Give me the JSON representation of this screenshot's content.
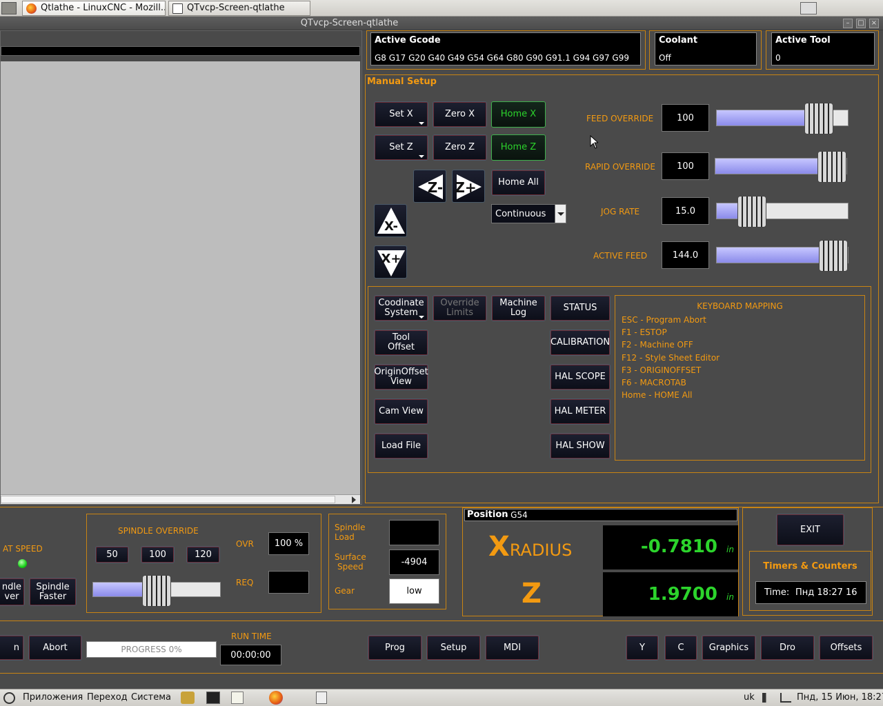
{
  "taskbar_top": {
    "tabs": [
      {
        "label": "Qtlathe - LinuxCNC - Mozill..."
      },
      {
        "label": "QTvcp-Screen-qtlathe"
      }
    ]
  },
  "window": {
    "title": "QTvcp-Screen-qtlathe",
    "buttons": [
      "–",
      "□",
      "×"
    ]
  },
  "active_gcode": {
    "title": "Active Gcode",
    "value": "G8 G17 G20 G40 G49 G54 G64 G80 G90 G91.1 G94 G97 G99"
  },
  "coolant": {
    "title": "Coolant",
    "value": "Off"
  },
  "active_tool": {
    "title": "Active Tool",
    "value": "0"
  },
  "manual_setup": {
    "title": "Manual Setup",
    "set_x": "Set X",
    "zero_x": "Zero X",
    "home_x": "Home X",
    "set_z": "Set Z",
    "zero_z": "Zero Z",
    "home_z": "Home Z",
    "home_all": "Home All",
    "jog_mode": "Continuous",
    "jog_labels": {
      "z_minus": "Z-",
      "z_plus": "Z+",
      "x_minus": "X-",
      "x_plus": "X+"
    }
  },
  "overrides": [
    {
      "label": "FEED OVERRIDE",
      "value": "100",
      "level": 0.86
    },
    {
      "label": "RAPID OVERRIDE",
      "value": "100",
      "level": 1.0
    },
    {
      "label": "JOG RATE",
      "value": "15.0",
      "level": 0.2
    },
    {
      "label": "ACTIVE FEED",
      "value": "144.0",
      "level": 1.0
    }
  ],
  "tools": {
    "coord_system": "Coodinate\nSystem",
    "override_limits": "Override\nLimits",
    "machine_log": "Machine\nLog",
    "status": "STATUS",
    "tool_offset": "Tool\nOffset",
    "calibration": "CALIBRATION",
    "origin_offset": "OriginOffset\nView",
    "hal_scope": "HAL SCOPE",
    "cam_view": "Cam View",
    "hal_meter": "HAL METER",
    "load_file": "Load File",
    "hal_show": "HAL SHOW"
  },
  "keyboard_mapping": {
    "title": "KEYBOARD MAPPING",
    "lines": [
      "ESC - Program Abort",
      "F1 - ESTOP",
      "F2 - Machine OFF",
      "F12 - Style Sheet Editor",
      "F3 - ORIGINOFFSET",
      "F6 - MACROTAB",
      "Home - HOME All"
    ]
  },
  "spindle": {
    "at_speed": "AT SPEED",
    "slower": "ndle\nver",
    "faster": "Spindle\nFaster",
    "override_title": "SPINDLE OVERRIDE",
    "presets": [
      "50",
      "100",
      "120"
    ],
    "ovr_label": "OVR",
    "ovr_value": "100 %",
    "req_label": "REQ",
    "req_value": "",
    "override_level": 0.5,
    "load_label": "Spindle\nLoad",
    "load_value": "",
    "surface_label": "Surface\nSpeed",
    "surface_value": "-4904",
    "gear_label": "Gear",
    "gear_value": "low"
  },
  "position": {
    "title": "Position",
    "system": " - G54",
    "x_axis": "X",
    "x_sub": "RADIUS",
    "x_value": "-0.7810",
    "x_unit": "in",
    "z_axis": "Z",
    "z_value": "1.9700",
    "z_unit": "in"
  },
  "right_panel": {
    "exit": "EXIT",
    "timers_title": "Timers & Counters",
    "time_label": "Time:",
    "time_value": "Пнд 18:27 16"
  },
  "bottom": {
    "run": "n",
    "abort": "Abort",
    "progress": "PROGRESS 0%",
    "run_time_label": "RUN TIME",
    "run_time_value": "00:00:00",
    "tabs": [
      "Prog",
      "Setup",
      "MDI"
    ],
    "right_tabs": [
      "Y",
      "C",
      "Graphics",
      "Dro",
      "Offsets"
    ]
  },
  "taskbar_bottom": {
    "apps": "Приложения",
    "go": "Переход",
    "system": "Система",
    "layout": "uk",
    "clock": "Пнд, 15 Июн, 18:27"
  },
  "colors": {
    "accent": "#f39a11",
    "dro_green": "#2cd42c",
    "panel_bg": "#4a4a4a"
  }
}
